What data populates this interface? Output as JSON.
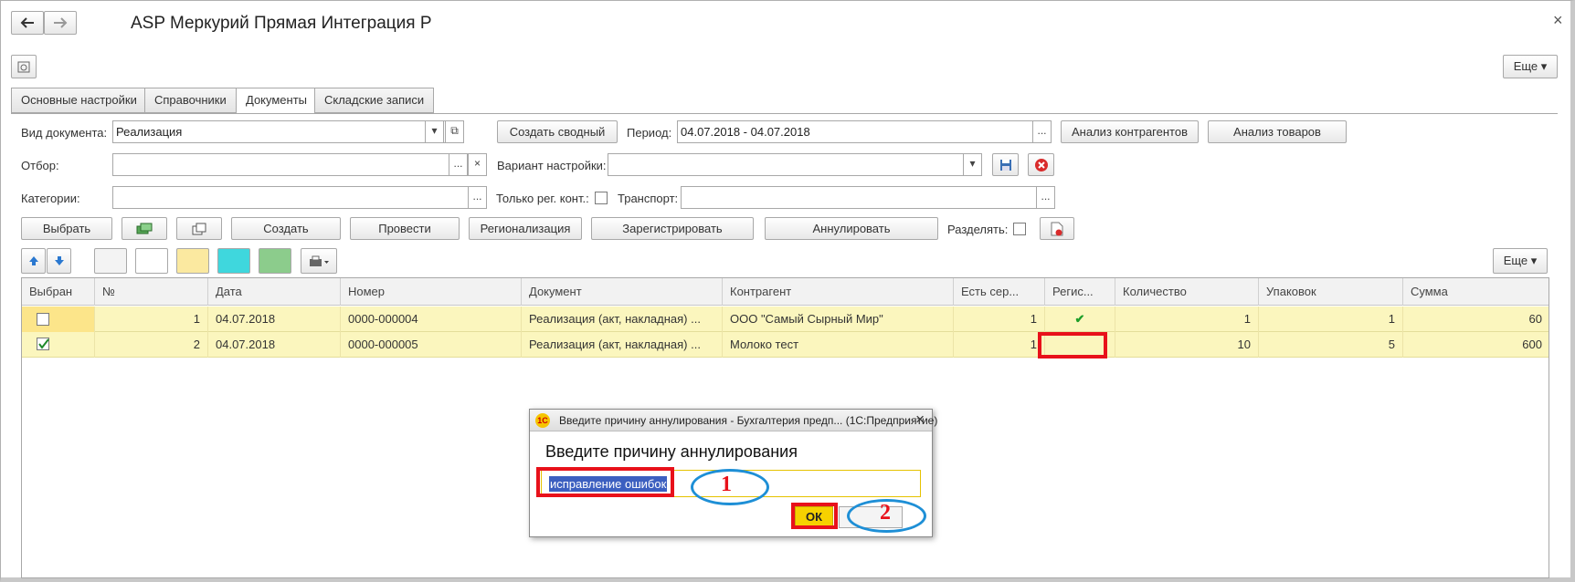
{
  "window": {
    "title": "ASP Меркурий Прямая Интеграция Р",
    "back_icon": "arrow-left-icon",
    "forward_icon": "arrow-right-icon",
    "close_glyph": "×",
    "more_label": "Еще ▾"
  },
  "tabs": [
    "Основные настройки",
    "Справочники",
    "Документы",
    "Складские записи"
  ],
  "active_tab": "Документы",
  "filters": {
    "doc_type_label": "Вид документа:",
    "doc_type_value": "Реализация",
    "create_summary": "Создать сводный",
    "period_label": "Период:",
    "period_value": "04.07.2018 - 04.07.2018",
    "analyze_contractors": "Анализ контрагентов",
    "analyze_goods": "Анализ товаров",
    "selection_label": "Отбор:",
    "selection_value": "",
    "setting_variant_label": "Вариант настройки:",
    "setting_variant_value": "",
    "categories_label": "Категории:",
    "categories_value": "",
    "only_reg_label": "Только рег. конт.:",
    "transport_label": "Транспорт:",
    "transport_value": "",
    "ellipsis": "...",
    "clear": "×"
  },
  "actions": {
    "select": "Выбрать",
    "create": "Создать",
    "post": "Провести",
    "regionalize": "Регионализация",
    "register": "Зарегистрировать",
    "annul": "Аннулировать",
    "split_label": "Разделять:",
    "more_label": "Еще ▾"
  },
  "colors": {
    "row_bg": "#fbf6be",
    "swatch_white1": "#f3f3f3",
    "swatch_white2": "#ffffff",
    "swatch_yellow": "#fbe9a0",
    "swatch_cyan": "#3fd7dd",
    "swatch_green": "#8ccc8c",
    "annotation_red": "#e8111a",
    "annotation_blue": "#1e8fd6"
  },
  "table": {
    "columns": [
      "Выбран",
      "№",
      "Дата",
      "Номер",
      "Документ",
      "Контрагент",
      "Есть сер...",
      "Регис...",
      "Количество",
      "Упаковок",
      "Сумма"
    ],
    "rows": [
      {
        "selected": false,
        "n": "1",
        "date": "04.07.2018",
        "number": "0000-000004",
        "document": "Реализация (акт, накладная) ...",
        "contractor": "ООО \"Самый  Сырный  Мир\"",
        "has_series": "1",
        "registered": "✔",
        "qty": "1",
        "packs": "1",
        "sum": "60"
      },
      {
        "selected": true,
        "n": "2",
        "date": "04.07.2018",
        "number": "0000-000005",
        "document": "Реализация (акт, накладная) ...",
        "contractor": "Молоко тест",
        "has_series": "1",
        "registered": "",
        "qty": "10",
        "packs": "5",
        "sum": "600"
      }
    ]
  },
  "dialog": {
    "title": "Введите причину аннулирования - Бухгалтерия предп... (1С:Предприятие)",
    "logo_text": "1С",
    "heading": "Введите причину аннулирования",
    "input_value": "исправление ошибок",
    "ok_label": "ОК",
    "close_glyph": "×"
  },
  "annotations": {
    "label_1": "1",
    "label_2": "2"
  }
}
